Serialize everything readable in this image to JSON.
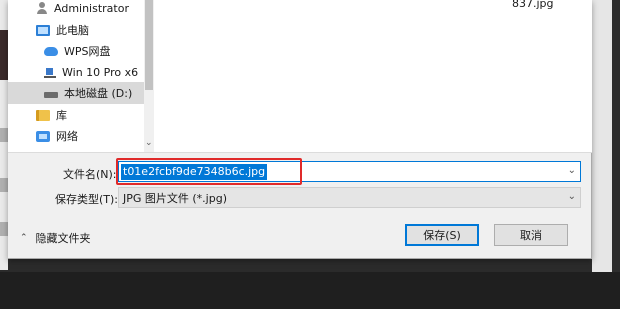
{
  "nav": {
    "items": [
      {
        "label": "Administrator",
        "icon": "user-icon"
      },
      {
        "label": "此电脑",
        "icon": "this-pc-icon"
      },
      {
        "label": "WPS网盘",
        "icon": "cloud-drive-icon"
      },
      {
        "label": "Win 10 Pro x6",
        "icon": "windows-drive-icon"
      },
      {
        "label": "本地磁盘 (D:)",
        "icon": "local-disk-icon",
        "selected": true
      },
      {
        "label": "库",
        "icon": "library-icon"
      },
      {
        "label": "网络",
        "icon": "network-icon"
      }
    ]
  },
  "file_pane": {
    "partial_filename": "837.jpg"
  },
  "form": {
    "filename_label": "文件名(N):",
    "filename_value": "t01e2fcbf9de7348b6c.jpg",
    "filetype_label": "保存类型(T):",
    "filetype_value": "JPG 图片文件 (*.jpg)"
  },
  "footer": {
    "hide_folders_label": "隐藏文件夹",
    "save_label": "保存(S)",
    "cancel_label": "取消"
  },
  "colors": {
    "selection": "#0078d7",
    "highlight_box": "#e02a2a"
  }
}
